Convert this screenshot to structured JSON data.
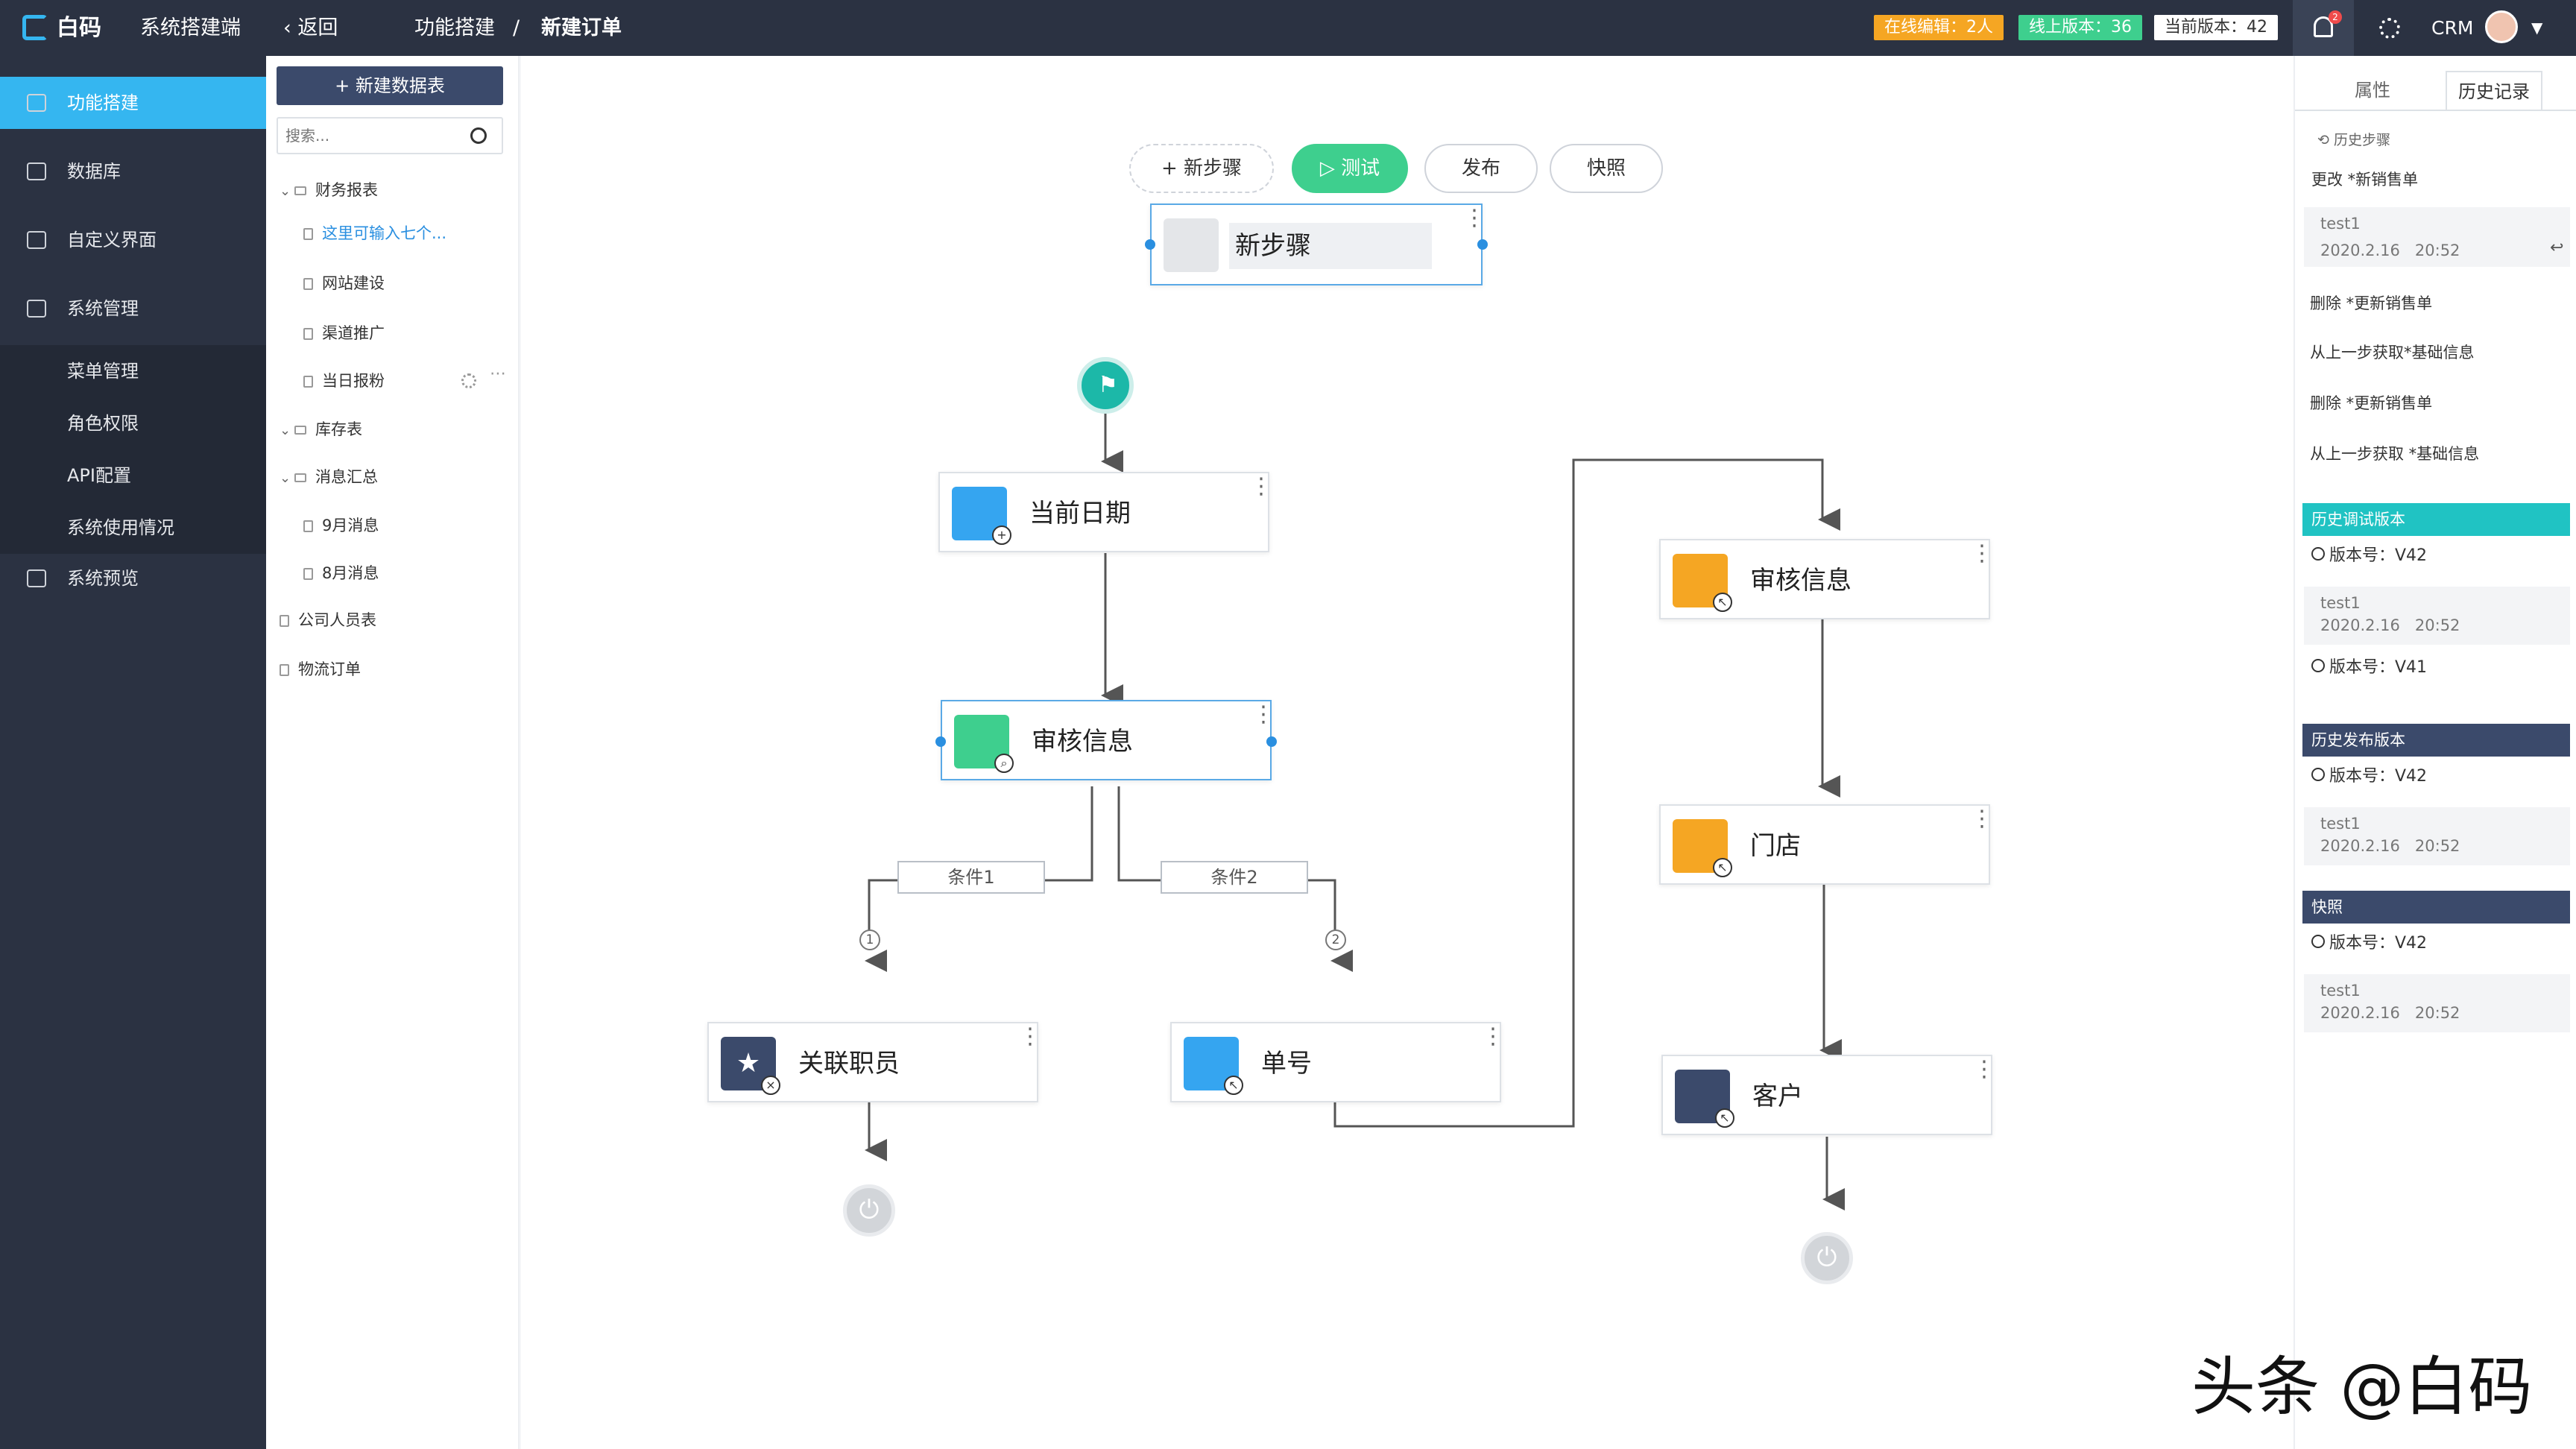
{
  "topbar": {
    "logo": "白码",
    "app": "系统搭建端",
    "back": "返回",
    "crumb1": "功能搭建",
    "sep": "/",
    "crumb2": "新建订单",
    "online": "在线编辑：2人",
    "live_version": "线上版本：36",
    "current_version": "当前版本：42",
    "notif_count": "2",
    "user": "CRM"
  },
  "sidebar": {
    "items": [
      {
        "label": "功能搭建"
      },
      {
        "label": "数据库"
      },
      {
        "label": "自定义界面"
      },
      {
        "label": "系统管理"
      },
      {
        "label": "系统预览"
      }
    ],
    "sub": [
      {
        "label": "菜单管理"
      },
      {
        "label": "角色权限"
      },
      {
        "label": "API配置"
      },
      {
        "label": "系统使用情况"
      }
    ]
  },
  "tree": {
    "new_table": "+ 新建数据表",
    "search_placeholder": "搜索...",
    "rows": [
      "财务报表",
      "这里可输入七个...",
      "网站建设",
      "渠道推广",
      "当日报粉",
      "库存表",
      "消息汇总",
      "9月消息",
      "8月消息",
      "公司人员表",
      "物流订单"
    ]
  },
  "toolbar": {
    "new_step": "+ 新步骤",
    "test": "▷ 测试",
    "publish": "发布",
    "snapshot": "快照"
  },
  "flow": {
    "edit_node": "新步骤",
    "nodes": [
      "当前日期",
      "审核信息",
      "关联职员",
      "单号",
      "审核信息",
      "门店",
      "客户"
    ],
    "cond1": "条件1",
    "cond2": "条件2",
    "n1": "1",
    "n2": "2"
  },
  "right": {
    "tab_props": "属性",
    "tab_history": "历史记录",
    "history_title": "历史步骤",
    "h1": "更改 *新销售单",
    "h_user": "test1",
    "h_time": "2020.2.16   20:52",
    "h2": "删除 *更新销售单",
    "h3": "从上一步获取*基础信息",
    "h4": "删除 *更新销售单",
    "h5": "从上一步获取 *基础信息",
    "sec_debug": "历史调试版本",
    "sec_publish": "历史发布版本",
    "sec_snapshot": "快照",
    "v42": "版本号：V42",
    "v41": "版本号：V41",
    "user": "test1",
    "time": "2020.2.16   20:52"
  },
  "watermark": "头条 @白码",
  "colors": {
    "accent": "#35b6f0",
    "green": "#3ecf8e",
    "orange": "#f5a623",
    "navy": "#3b4a6b"
  }
}
